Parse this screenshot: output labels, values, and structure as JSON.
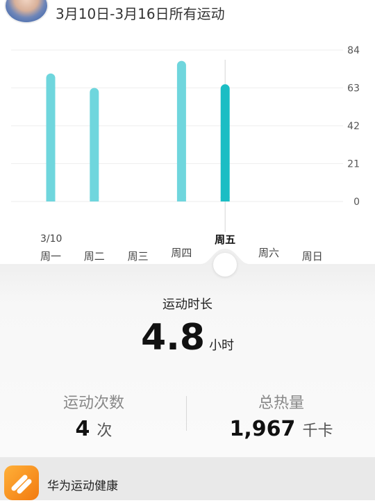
{
  "header": {
    "title": "3月10日-3月16日所有运动"
  },
  "chart_data": {
    "type": "bar",
    "categories": [
      "周一",
      "周二",
      "周三",
      "周四",
      "周五",
      "周六",
      "周日"
    ],
    "values": [
      71,
      63,
      0,
      78,
      65,
      0,
      0
    ],
    "selected_index": 4,
    "date_label": "3/10",
    "yticks": [
      "84",
      "63",
      "42",
      "21",
      "0"
    ],
    "ylim": [
      0,
      84
    ],
    "y_axis_side": "right",
    "grid": true,
    "colors": {
      "bar": "#6fd6dd",
      "selected_bar": "#1bbdc4",
      "grid": "#eeeeee"
    }
  },
  "summary": {
    "title": "运动时长",
    "value": "4.8",
    "unit": "小时"
  },
  "stats": {
    "count_label": "运动次数",
    "count_value": "4",
    "count_unit": "次",
    "calories_label": "总热量",
    "calories_value": "1,967",
    "calories_unit": "千卡"
  },
  "footer": {
    "app_name": "华为运动健康",
    "app_icon": "huawei-health-icon"
  }
}
